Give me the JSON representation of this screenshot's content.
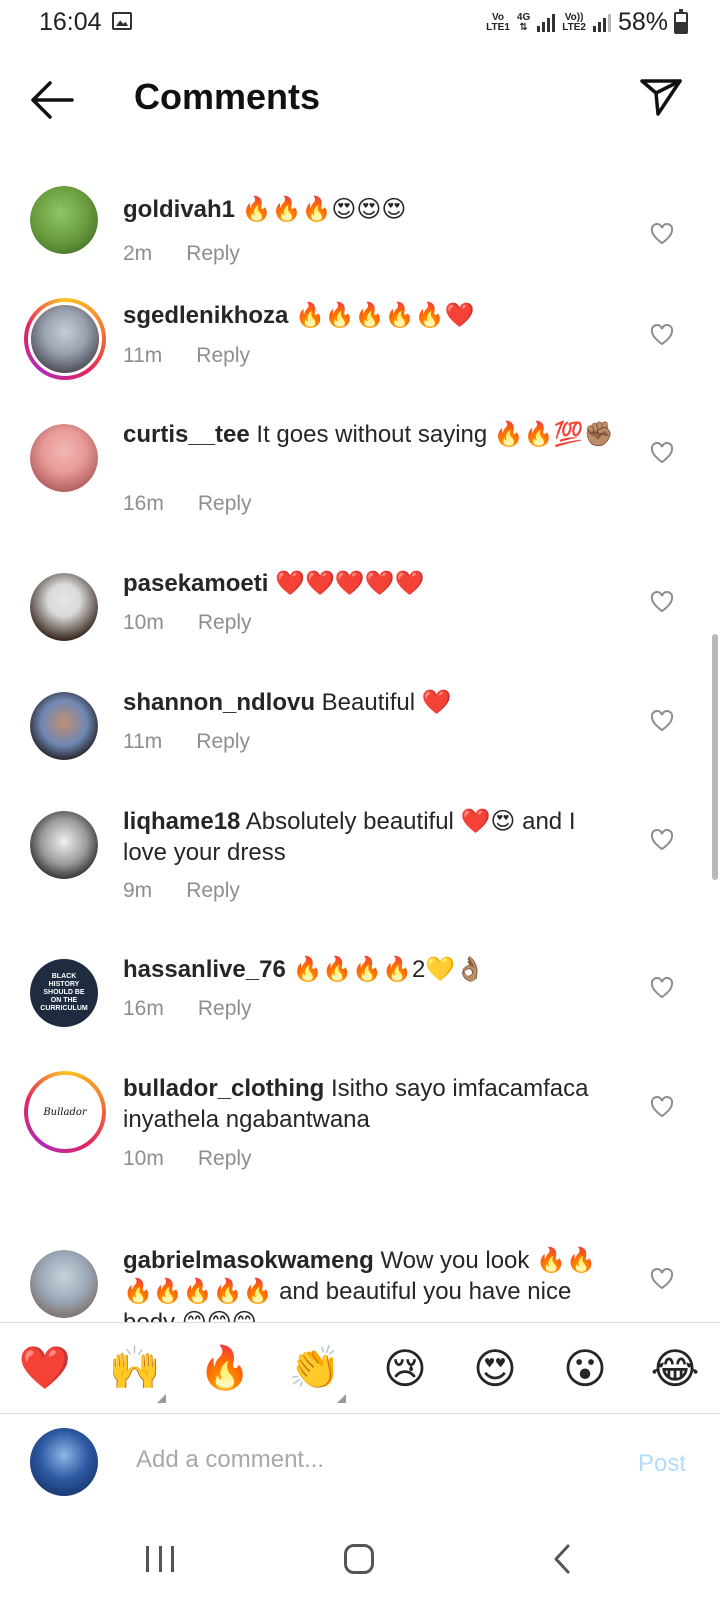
{
  "status_bar": {
    "time": "16:04",
    "network1_top": "Vo",
    "network1_bottom": "LTE1",
    "network_type": "4G",
    "network2_top": "Vo))",
    "network2_bottom": "LTE2",
    "battery": "58%"
  },
  "header": {
    "title": "Comments",
    "back_icon": "arrow-left-icon",
    "send_icon": "paper-plane-icon"
  },
  "comments": [
    {
      "username": "goldivah1",
      "text": "🔥🔥🔥😍😍😍",
      "time": "2m",
      "reply": "Reply",
      "avatar_colors": [
        "#6a9b3e",
        "#2f5e1d"
      ]
    },
    {
      "username": "sgedlenikhoza",
      "text": "🔥🔥🔥🔥🔥❤️",
      "time": "11m",
      "reply": "Reply",
      "avatar_colors": [
        "#9aa2b0",
        "#1b1b1f"
      ]
    },
    {
      "username": "curtis__tee",
      "text": "It goes without saying 🔥🔥💯✊🏽",
      "time": "16m",
      "reply": "Reply",
      "avatar_colors": [
        "#e89a96",
        "#8f3a3c"
      ]
    },
    {
      "username": "pasekamoeti",
      "text": "❤️❤️❤️❤️❤️",
      "time": "10m",
      "reply": "Reply",
      "avatar_colors": [
        "#d9d9d9",
        "#3b2a21"
      ]
    },
    {
      "username": "shannon_ndlovu",
      "text": "Beautiful ❤️",
      "time": "11m",
      "reply": "Reply",
      "avatar_colors": [
        "#6f88b3",
        "#1a1414"
      ]
    },
    {
      "username": "liqhame18",
      "text": "Absolutely beautiful ❤️😍 and I love your dress",
      "time": "9m",
      "reply": "Reply",
      "avatar_colors": [
        "#f0f0f0",
        "#202020"
      ]
    },
    {
      "username": "hassanlive_76",
      "text": "🔥🔥🔥🔥2💛👌🏽",
      "time": "16m",
      "reply": "Reply",
      "avatar_colors": [
        "#1f2c3f",
        "#0e1622"
      ],
      "avatar_text": "BLACK HISTORY SHOULD BE ON THE CURRICULUM"
    },
    {
      "username": "bullador_clothing",
      "text": "Isitho sayo imfacamfaca inyathela ngabantwana",
      "time": "10m",
      "reply": "Reply",
      "avatar_colors": [
        "#ffffff",
        "#ffffff"
      ],
      "avatar_text": "Bullador"
    },
    {
      "username": "gabrielmasokwameng",
      "text": "Wow you look 🔥🔥🔥🔥🔥🔥🔥 and beautiful you have nice body 😊😊😊",
      "time": "",
      "reply": "",
      "avatar_colors": [
        "#9aa9b8",
        "#6c4a3a"
      ]
    }
  ],
  "quick_reactions": [
    "❤️",
    "🙌",
    "🔥",
    "👏",
    "😢",
    "😍",
    "😮",
    "😂"
  ],
  "comment_input": {
    "placeholder": "Add a comment...",
    "post_label": "Post"
  },
  "nav_bar": {
    "recent_icon": "recent-apps-icon",
    "home_icon": "home-icon",
    "back_icon": "nav-back-icon"
  }
}
